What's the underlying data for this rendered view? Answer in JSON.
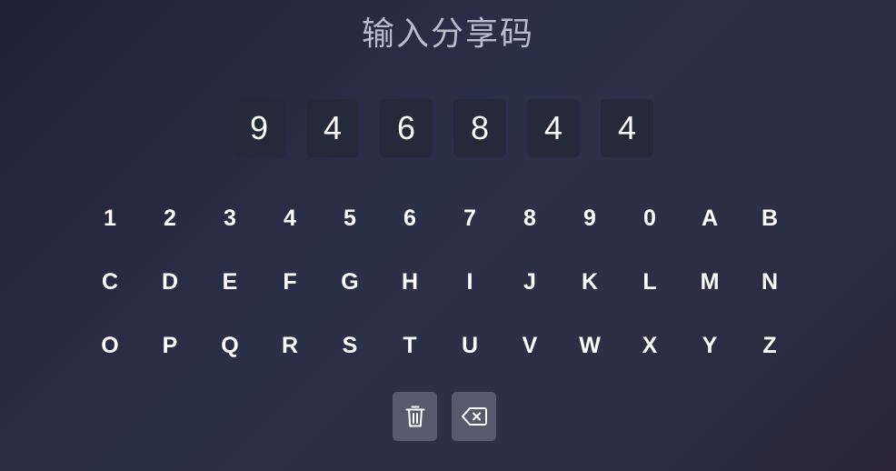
{
  "title": "输入分享码",
  "code": [
    "9",
    "4",
    "6",
    "8",
    "4",
    "4"
  ],
  "keyboard": {
    "rows": [
      [
        "1",
        "2",
        "3",
        "4",
        "5",
        "6",
        "7",
        "8",
        "9",
        "0",
        "A",
        "B"
      ],
      [
        "C",
        "D",
        "E",
        "F",
        "G",
        "H",
        "I",
        "J",
        "K",
        "L",
        "M",
        "N"
      ],
      [
        "O",
        "P",
        "Q",
        "R",
        "S",
        "T",
        "U",
        "V",
        "W",
        "X",
        "Y",
        "Z"
      ]
    ]
  },
  "actions": {
    "clear_icon": "trash-icon",
    "backspace_icon": "backspace-icon"
  },
  "colors": {
    "title": "#b9bcc8",
    "code_box_bg": "#252a3b",
    "action_button_bg": "#575a6c",
    "text": "#ffffff"
  }
}
